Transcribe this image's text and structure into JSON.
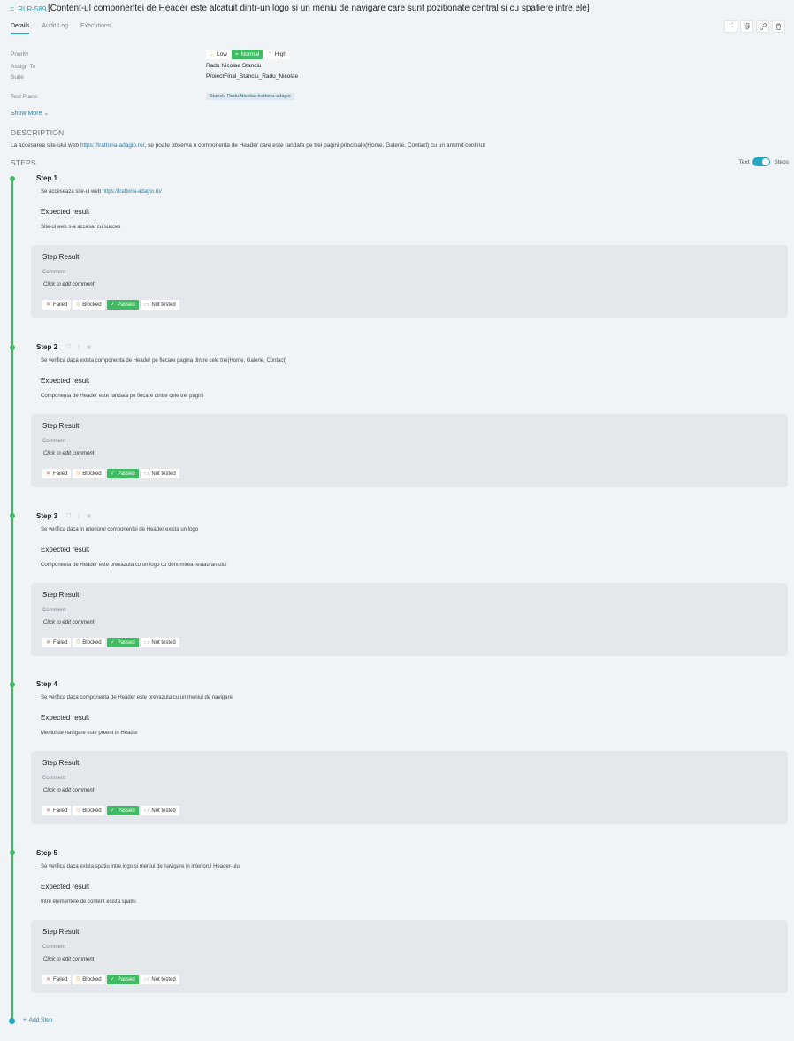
{
  "header": {
    "case_id": "RLR-589",
    "title": "[Content-ul componentei de Header este alcatuit dintr-un logo si un meniu de navigare care sunt pozitionate central si cu spatiere intre ele]",
    "tabs": [
      "Details",
      "Audit Log",
      "Executions"
    ],
    "active_tab": "Details",
    "icons": [
      "expand-icon",
      "attachment-icon",
      "link-icon",
      "trash-icon"
    ]
  },
  "properties": {
    "priority_label": "Priority",
    "priority_options": [
      {
        "label": "Low",
        "icon": "chevron-down-icon"
      },
      {
        "label": "Normal",
        "icon": "equals-icon"
      },
      {
        "label": "High",
        "icon": "chevron-up-icon"
      }
    ],
    "priority_selected": "Normal",
    "assign_label": "Assign To",
    "assign_value": "Radu Nicolae Stanciu",
    "suite_label": "Suite",
    "suite_value": "ProiectFinal_Stanciu_Radu_Nicolae",
    "plans_label": "Test Plans",
    "plans_value": "Stanciu Radu Nicolae-trattoria-adagio",
    "show_more": "Show More"
  },
  "description": {
    "title": "DESCRIPTION",
    "text_before": "La accesarea site-ului web ",
    "link": "https://trattoria-adagio.ro/",
    "text_after": ", se poate observa o componenta de Header care este randata pe trei pagini principale(Home, Galerie, Contact) cu un anumit continut"
  },
  "steps_section": {
    "title": "STEPS",
    "toggle_left": "Text",
    "toggle_right": "Steps",
    "toggle_on": true
  },
  "common": {
    "expected_label": "Expected result",
    "result_title": "Step Result",
    "comment_label": "Comment",
    "comment_placeholder": "Click to edit comment",
    "btn_failed": "Failed",
    "btn_blocked": "Blocked",
    "btn_passed": "Passed",
    "btn_not_tested": "Not tested"
  },
  "steps": [
    {
      "label": "Step 1",
      "action_before": "Se acceseaza site-ul web ",
      "action_link": "https://trattoria-adagio.ro/",
      "action_after": "",
      "expected": "Site-ul web s-a accesat cu succes",
      "status": "Passed",
      "show_tools": false
    },
    {
      "label": "Step 2",
      "action_before": "Se verifica daca exista componenta de Header pe fiecare pagina dintre cele trei(Home, Galerie, Contact)",
      "action_link": "",
      "action_after": "",
      "expected": "Componenta de Header este randata pe fiecare dintre cele trei pagini",
      "status": "Passed",
      "show_tools": true
    },
    {
      "label": "Step 3",
      "action_before": "Se verifica daca in interiorul componentei de Header exista un logo",
      "action_link": "",
      "action_after": "",
      "expected": "Componenta de Header este prevazuta cu un logo cu denumirea restaurantului",
      "status": "Passed",
      "show_tools": true
    },
    {
      "label": "Step 4",
      "action_before": "Se verifica daca componenta de Header este prevazuta cu un meniul de navigare",
      "action_link": "",
      "action_after": "",
      "expected": "Meniul de navigare este preent in Header",
      "status": "Passed",
      "show_tools": false
    },
    {
      "label": "Step 5",
      "action_before": "Se verifica daca exista spatiu intre logo si meniul de navigare in interiorul Header-ului",
      "action_link": "",
      "action_after": "",
      "expected": "Intre elementele de content exista spatiu",
      "status": "Passed",
      "show_tools": false
    }
  ],
  "add_step": "Add Step"
}
